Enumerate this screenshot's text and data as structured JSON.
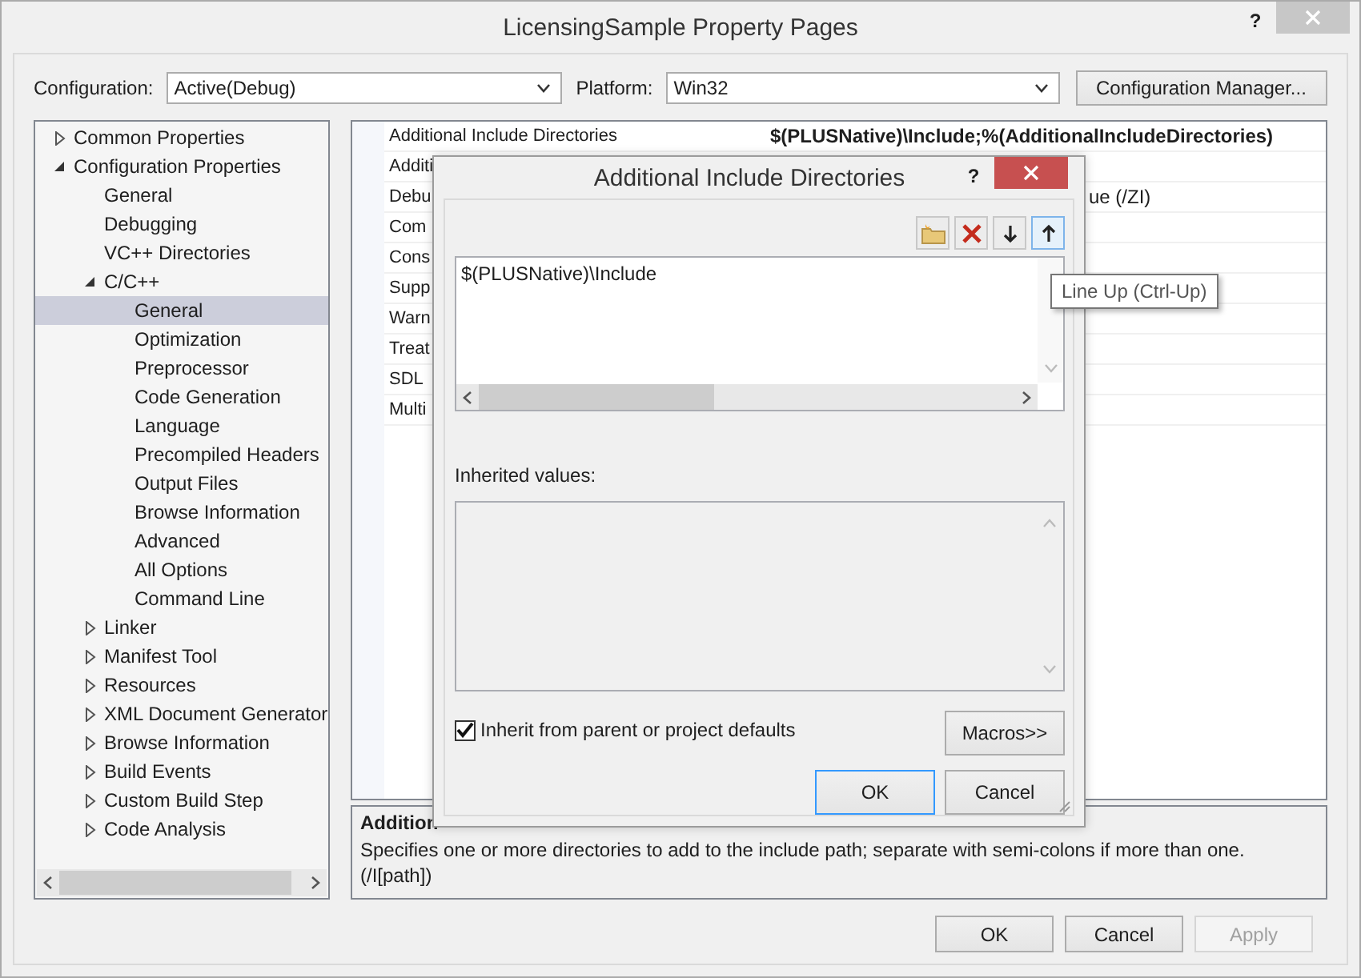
{
  "window": {
    "title": "LicensingSample Property Pages",
    "help": "?"
  },
  "toolbar": {
    "configuration_label": "Configuration:",
    "configuration": "Active(Debug)",
    "platform_label": "Platform:",
    "platform": "Win32",
    "manager_button": "Configuration Manager..."
  },
  "tree": [
    {
      "label": "Common Properties",
      "expanded": false,
      "selected": false
    },
    {
      "label": "Configuration Properties",
      "expanded": true,
      "selected": false,
      "children": [
        {
          "label": "General",
          "selected": false
        },
        {
          "label": "Debugging",
          "selected": false
        },
        {
          "label": "VC++ Directories",
          "selected": false
        },
        {
          "label": "C/C++",
          "expanded": true,
          "selected": false,
          "children": [
            {
              "label": "General",
              "selected": true
            },
            {
              "label": "Optimization",
              "selected": false
            },
            {
              "label": "Preprocessor",
              "selected": false
            },
            {
              "label": "Code Generation",
              "selected": false
            },
            {
              "label": "Language",
              "selected": false
            },
            {
              "label": "Precompiled Headers",
              "selected": false
            },
            {
              "label": "Output Files",
              "selected": false
            },
            {
              "label": "Browse Information",
              "selected": false
            },
            {
              "label": "Advanced",
              "selected": false
            },
            {
              "label": "All Options",
              "selected": false
            },
            {
              "label": "Command Line",
              "selected": false
            }
          ]
        },
        {
          "label": "Linker",
          "expanded": false,
          "selected": false
        },
        {
          "label": "Manifest Tool",
          "expanded": false,
          "selected": false
        },
        {
          "label": "Resources",
          "expanded": false,
          "selected": false
        },
        {
          "label": "XML Document Generator",
          "expanded": false,
          "selected": false
        },
        {
          "label": "Browse Information",
          "expanded": false,
          "selected": false
        },
        {
          "label": "Build Events",
          "expanded": false,
          "selected": false
        },
        {
          "label": "Custom Build Step",
          "expanded": false,
          "selected": false
        },
        {
          "label": "Code Analysis",
          "expanded": false,
          "selected": false
        }
      ]
    }
  ],
  "grid": {
    "rows": [
      {
        "name": "Additional Include Directories",
        "value": "$(PLUSNative)\\Include;%(AdditionalIncludeDirectories)",
        "modified": true
      },
      {
        "name": "Additi"
      },
      {
        "name": "Debu",
        "value": "ue (/ZI)",
        "modified": false
      },
      {
        "name": "Com"
      },
      {
        "name": "Cons"
      },
      {
        "name": "Supp"
      },
      {
        "name": "Warn"
      },
      {
        "name": "Treat"
      },
      {
        "name": "SDL"
      },
      {
        "name": "Multi"
      }
    ]
  },
  "description": {
    "title": "Addition",
    "text": "Specifies one or more directories to add to the include path; separate with semi-colons if more than one.",
    "switch": "(/I[path])"
  },
  "buttons": [
    {
      "label": "OK",
      "disabled": false
    },
    {
      "label": "Cancel",
      "disabled": false
    },
    {
      "label": "Apply",
      "disabled": true
    }
  ],
  "dialog": {
    "title": "Additional Include Directories",
    "help": "?",
    "entries": [
      "$(PLUSNative)\\Include"
    ],
    "tooltip": "Line Up (Ctrl-Up)",
    "inherited_label": "Inherited values:",
    "inherit_checkbox": {
      "label": "Inherit from parent or project defaults",
      "checked": true
    },
    "macros_button": "Macros>>",
    "buttons": [
      {
        "label": "OK",
        "default": true
      },
      {
        "label": "Cancel",
        "default": false
      }
    ]
  }
}
